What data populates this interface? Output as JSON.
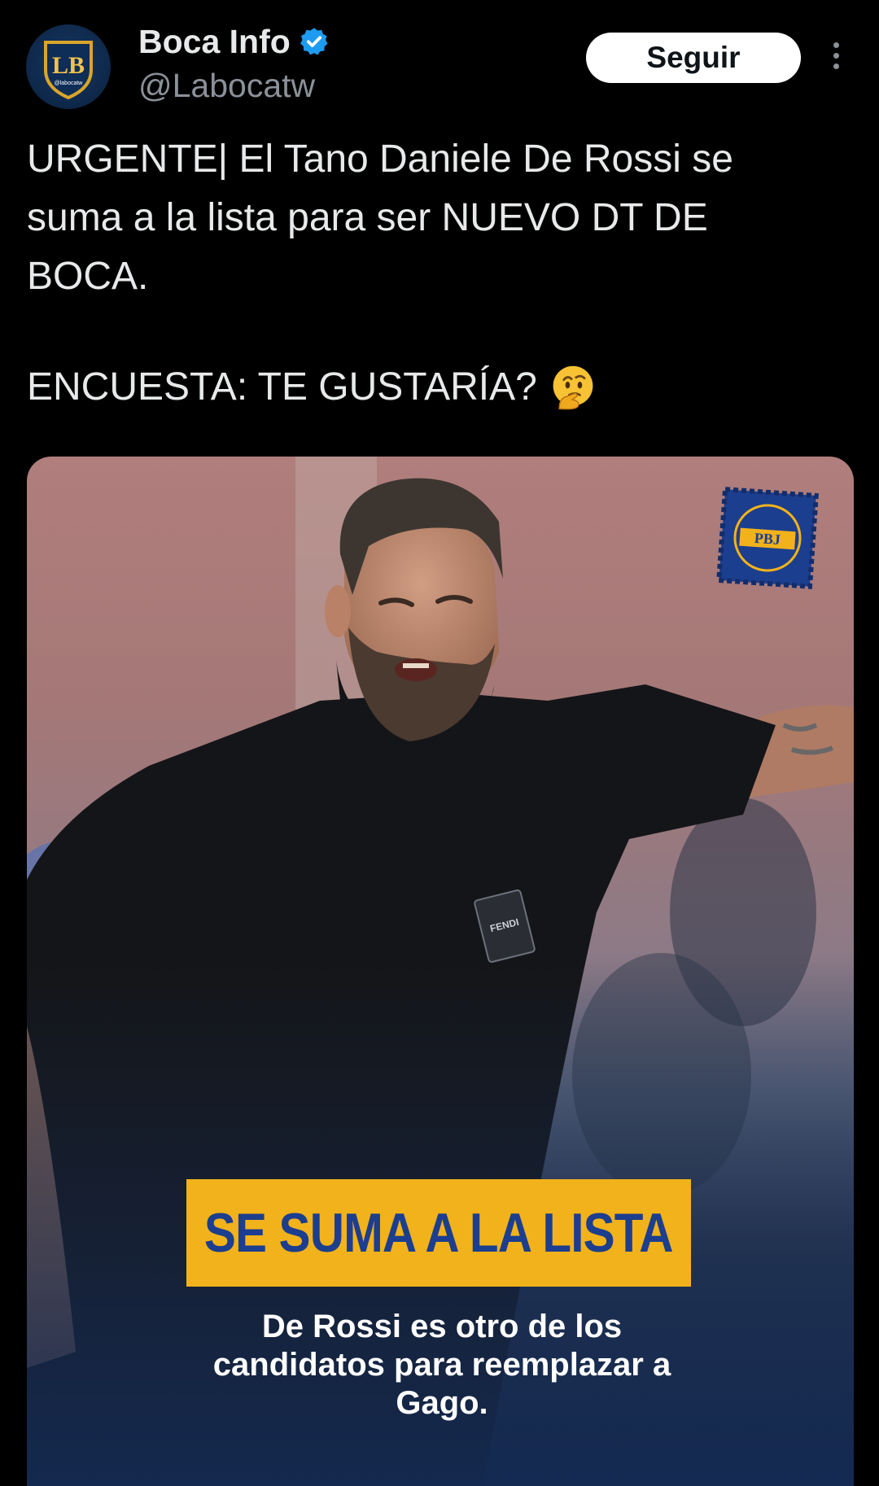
{
  "account": {
    "display_name": "Boca Info",
    "handle": "@Labocatw",
    "avatar_logo_text": "LB",
    "avatar_sub_text": "@labocatw",
    "verified_icon": "verified-badge-icon",
    "verified_color": "#1d9bf0"
  },
  "actions": {
    "follow_label": "Seguir",
    "more_icon": "more-options-icon"
  },
  "tweet": {
    "body": "URGENTE| El Tano Daniele De Rossi se\nsuma a la lista para ser NUEVO DT DE\nBOCA.",
    "poll_text": "ENCUESTA: TE GUSTARÍA?",
    "emoji": "thinking-face-emoji"
  },
  "media": {
    "stamp_text": "PBJ",
    "shirt_tag_text": "FENDI",
    "banner_text": "SE SUMA A LA LISTA",
    "caption": "De Rossi es otro de los\ncandidatos para reemplazar a\nGago.",
    "banner_color": "#f2b21b",
    "banner_text_color": "#1c3e8e"
  }
}
